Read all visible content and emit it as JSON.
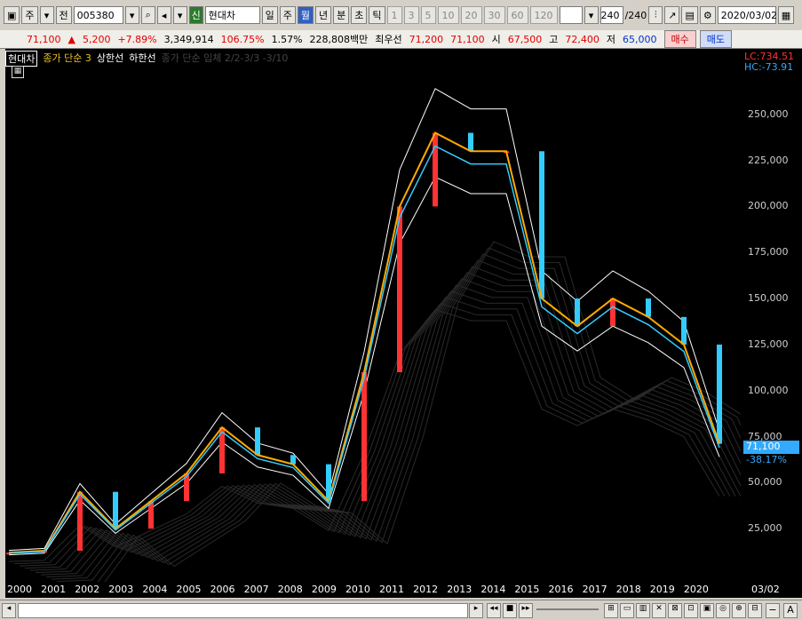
{
  "toolbar": {
    "type_label": "주",
    "prev_label": "전",
    "code": "005380",
    "badge": "신",
    "name": "현대차",
    "periods": [
      "일",
      "주",
      "월",
      "년",
      "분",
      "초",
      "틱"
    ],
    "intervals": [
      "1",
      "3",
      "5",
      "10",
      "20",
      "30",
      "60",
      "120"
    ],
    "count": "240",
    "count_total": "/240",
    "date": "2020/03/02"
  },
  "quote": {
    "price": "71,100",
    "arrow": "▲",
    "change": "5,200",
    "change_pct": "+7.89%",
    "volume": "3,349,914",
    "volume_ratio": "106.75%",
    "turnover": "1.57%",
    "amount": "228,808백만",
    "best_label": "최우선",
    "bid_best": "71,200",
    "ask_best": "71,100",
    "open_label": "시",
    "open": "67,500",
    "high_label": "고",
    "high": "72,400",
    "low_label": "저",
    "low": "65,000",
    "buy_label": "매수",
    "sell_label": "매도"
  },
  "legend": {
    "name": "현대차",
    "series1": "종가 단순 3",
    "series2": "상한선",
    "series3": "하한선",
    "series4": "종가 단순 입체 2/2-3/3 -3/10"
  },
  "price_axis": {
    "lc_label": "LC:734.51",
    "hc_label": "HC:-73.91",
    "ticks": [
      "250,000",
      "225,000",
      "200,000",
      "175,000",
      "150,000",
      "125,000",
      "100,000",
      "75,000",
      "50,000",
      "25,000"
    ],
    "current": "71,100",
    "current_pct": "-38.17%"
  },
  "date_axis": {
    "labels": [
      "2000",
      "2001",
      "2002",
      "2003",
      "2004",
      "2005",
      "2006",
      "2007",
      "2008",
      "2009",
      "2010",
      "2011",
      "2012",
      "2013",
      "2014",
      "2015",
      "2016",
      "2017",
      "2018",
      "2019",
      "2020"
    ],
    "end_label": "03/02"
  },
  "colors": {
    "up": "#ff3333",
    "down": "#33ccff",
    "ma": "#ffaa00",
    "envelope": "#ffffff"
  },
  "chart_data": {
    "type": "line",
    "x": [
      "2000",
      "2001",
      "2002",
      "2003",
      "2004",
      "2005",
      "2006",
      "2007",
      "2008",
      "2009",
      "2010",
      "2011",
      "2012",
      "2013",
      "2014",
      "2015",
      "2016",
      "2017",
      "2018",
      "2019",
      "2020"
    ],
    "series": [
      {
        "values": [
          12000,
          13000,
          45000,
          25000,
          40000,
          55000,
          80000,
          65000,
          60000,
          40000,
          110000,
          200000,
          240000,
          230000,
          230000,
          150000,
          135000,
          150000,
          140000,
          125000,
          71100
        ]
      }
    ],
    "ylim": [
      0,
      275000
    ]
  }
}
